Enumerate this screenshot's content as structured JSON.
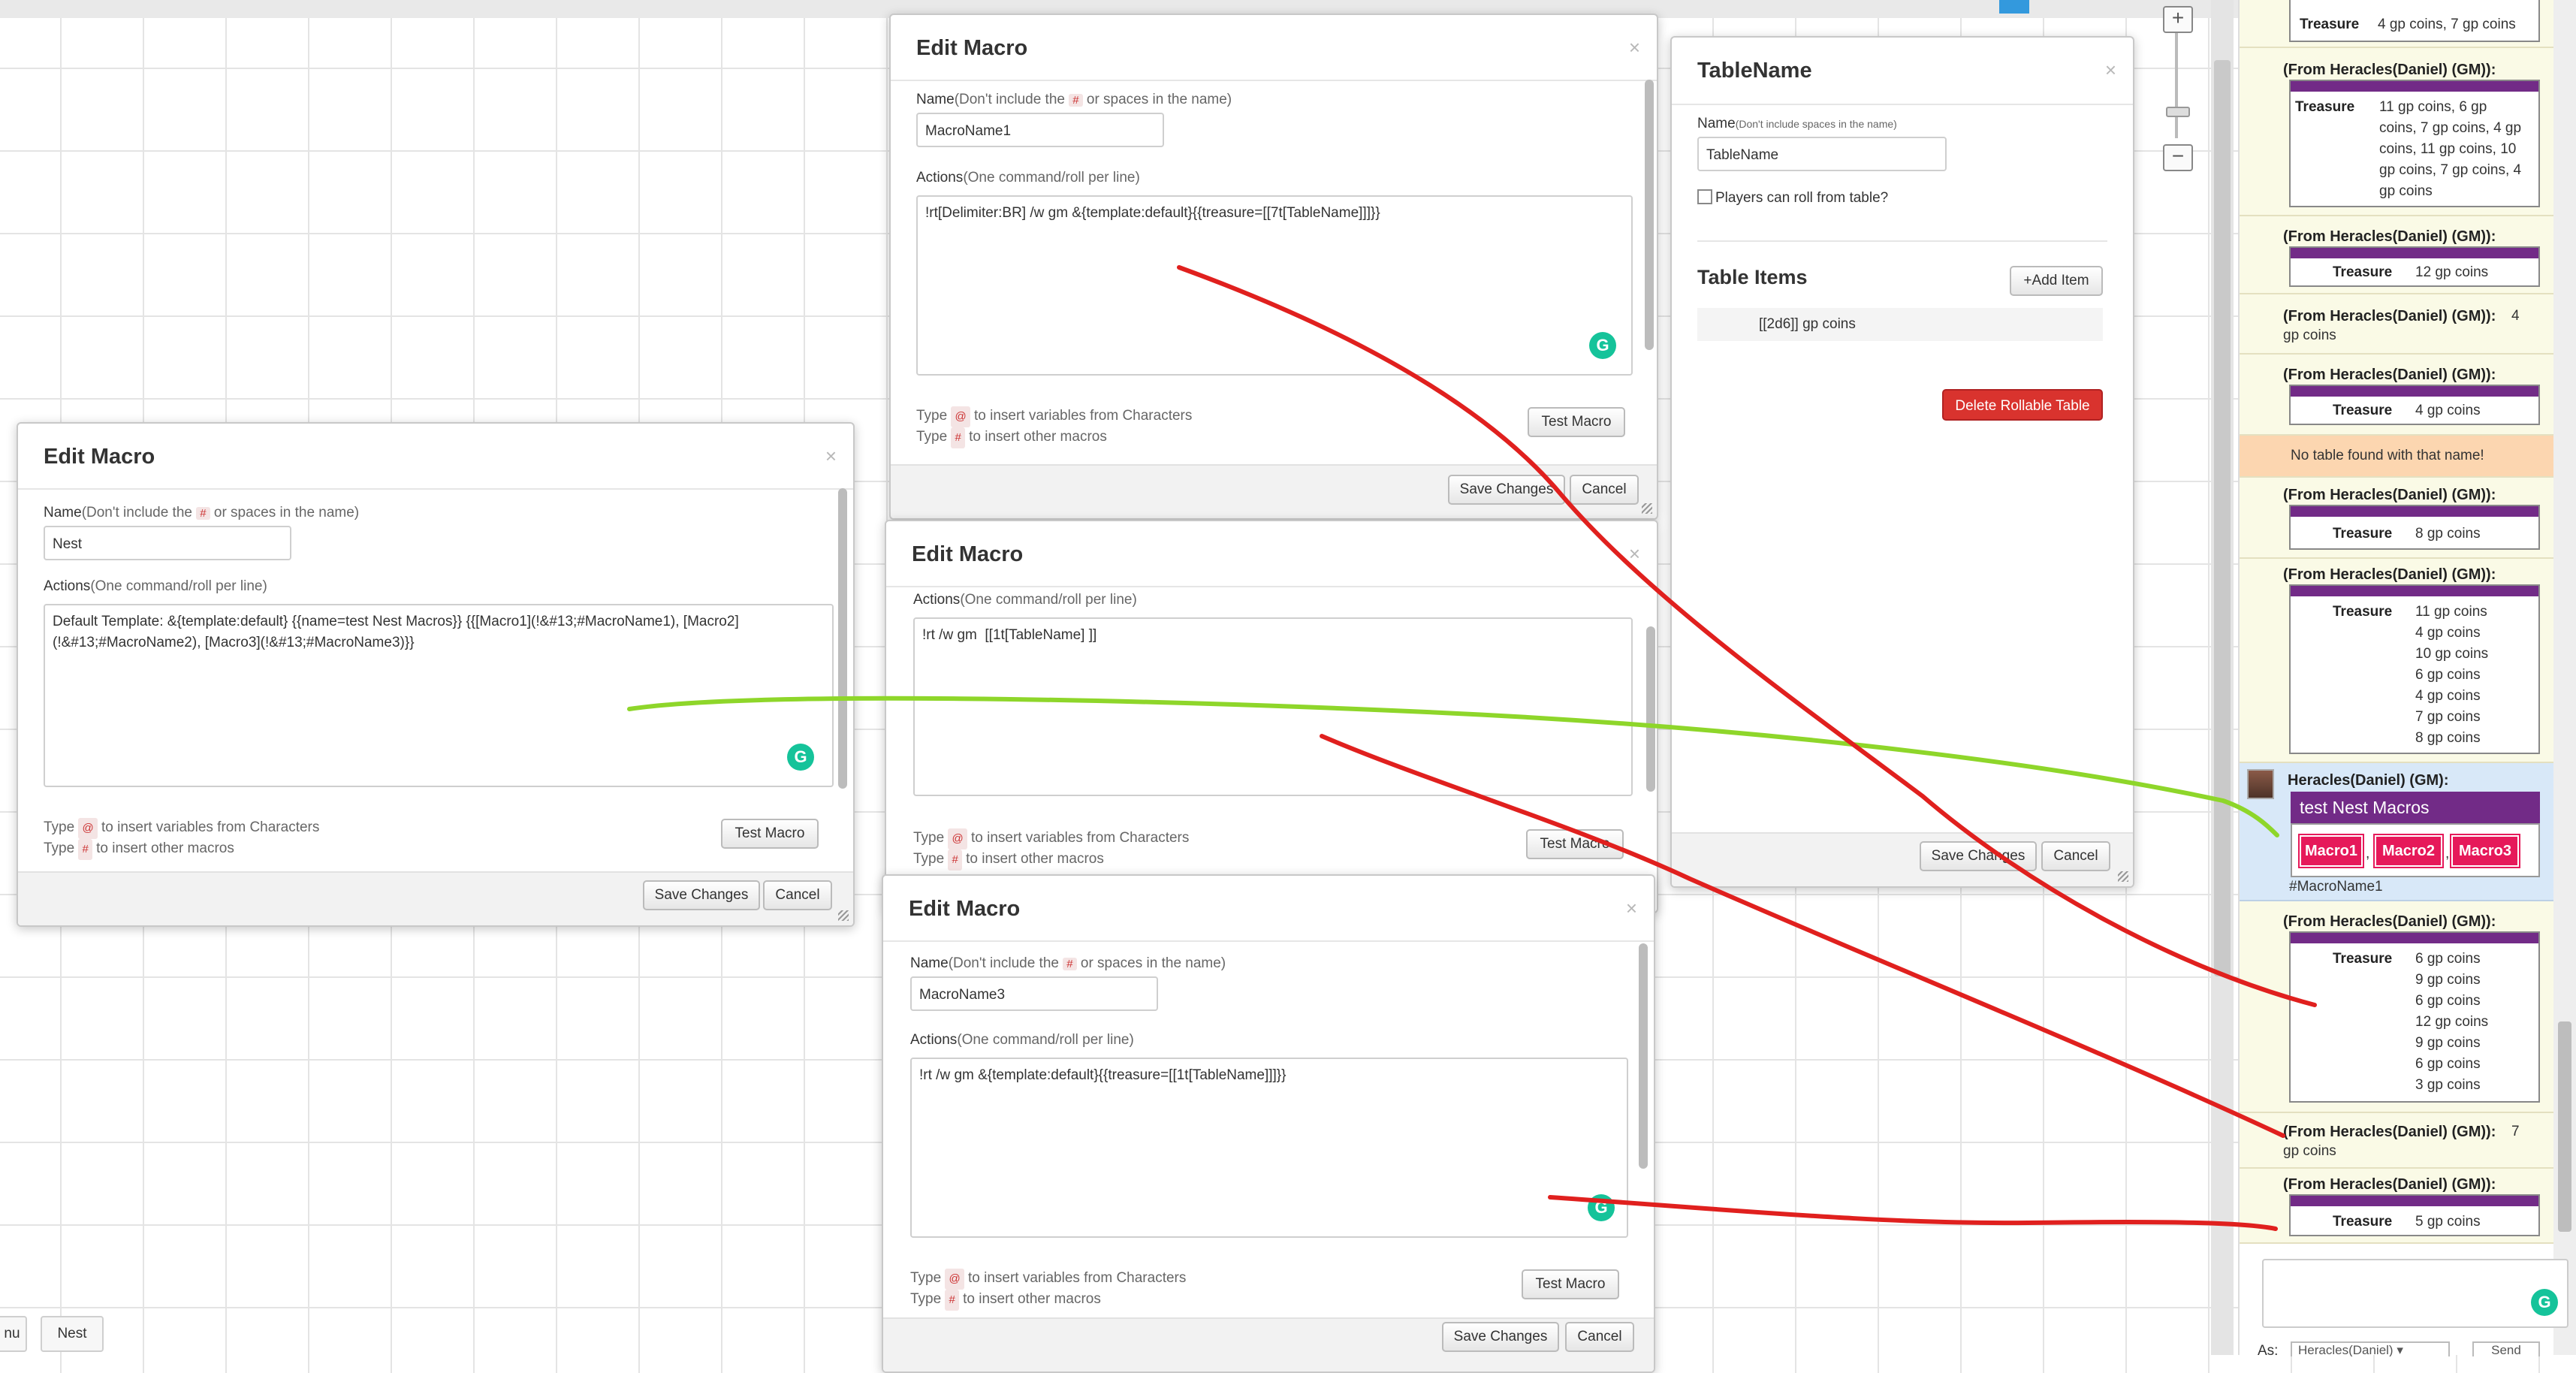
{
  "dialog_common": {
    "edit_macro_title": "Edit Macro",
    "name_label": "Name",
    "name_hint_pre": "(Don't include the ",
    "name_hint_hash": "#",
    "name_hint_post": " or spaces in the name)",
    "actions_label": "Actions",
    "actions_hint": "(One command/roll per line)",
    "type_at_pre": "Type ",
    "type_at_sym": "@",
    "type_at_post": " to insert variables from Characters",
    "type_hash_pre": "Type ",
    "type_hash_sym": "#",
    "type_hash_post": " to insert other macros",
    "test_macro": "Test Macro",
    "save_changes": "Save Changes",
    "cancel": "Cancel",
    "close": "×",
    "grammarly": "G"
  },
  "macro_nest": {
    "name_value": "Nest",
    "actions_value": "Default Template: &{template:default} {{name=test Nest Macros}} {{[Macro1](!&#13;#MacroName1), [Macro2](!&#13;#MacroName2), [Macro3](!&#13;#MacroName3)}}"
  },
  "macro_1": {
    "name_value": "MacroName1",
    "actions_value": "!rt[Delimiter:BR] /w gm &{template:default}{{treasure=[[7t[TableName]]]}}"
  },
  "macro_2": {
    "actions_value": "!rt /w gm  [[1t[TableName] ]]"
  },
  "macro_3": {
    "name_value": "MacroName3",
    "actions_value": "!rt /w gm &{template:default}{{treasure=[[1t[TableName]]]}}"
  },
  "table_panel": {
    "title": "TableName",
    "name_label": "Name",
    "name_hint": "(Don't include spaces in the name)",
    "name_value": "TableName",
    "players_roll": "Players can roll from table?",
    "items_heading": "Table Items",
    "add_item": "+Add Item",
    "item_1": "[[2d6]] gp coins",
    "delete_table": "Delete Rollable Table",
    "save_changes": "Save Changes",
    "cancel": "Cancel"
  },
  "chat": {
    "from_gm": "(From Heracles(Daniel) (GM)):",
    "treasure": "Treasure",
    "top_partial": "4 gp coins, 7 gp coins",
    "msg1": [
      "11 gp coins, 6 gp",
      "coins, 7 gp coins, 4 gp",
      "coins, 11 gp coins, 10",
      "gp coins, 7 gp coins, 4",
      "gp coins"
    ],
    "msg2": "12 gp coins",
    "msg3_tail": "4",
    "msg3_wrap": "gp coins",
    "msg4": "4 gp coins",
    "no_table": "No table found with that name!",
    "msg5": "8 gp coins",
    "msg6": [
      "11 gp coins",
      "4 gp coins",
      "10 gp coins",
      "6 gp coins",
      "4 gp coins",
      "7 gp coins",
      "8 gp coins"
    ],
    "heracles": "Heracles(Daniel) (GM):",
    "nest_title": "test Nest Macros",
    "m1": "Macro1",
    "m2": "Macro2",
    "m3": "Macro3",
    "comma": ",",
    "macroname1": "#MacroName1",
    "msg7": [
      "6 gp coins",
      "9 gp coins",
      "6 gp coins",
      "12 gp coins",
      "9 gp coins",
      "6 gp coins",
      "3 gp coins"
    ],
    "msg8_tail": "7",
    "msg8_wrap": "gp coins",
    "msg9": "5 gp coins",
    "as_label": "As:",
    "as_value": "Heracles(Daniel) ▾",
    "send": "Send"
  },
  "zoom": {
    "plus": "+",
    "minus": "−"
  },
  "bottom_tabs": [
    "nu",
    "Nest"
  ],
  "colors": {
    "template_purple": "#722b87",
    "macro_pink": "#e6195a",
    "annotation_red": "#e0201e",
    "annotation_green": "#8ed62a",
    "grammarly": "#15c39a"
  }
}
